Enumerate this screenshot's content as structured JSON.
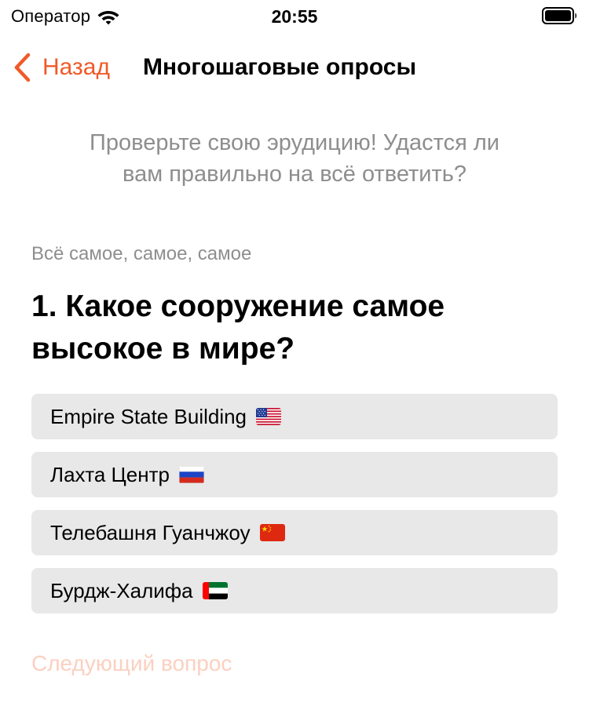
{
  "status_bar": {
    "carrier": "Оператор",
    "time": "20:55",
    "wifi_icon": "wifi-icon",
    "battery_icon": "battery-full-icon"
  },
  "nav": {
    "back_label": "Назад",
    "back_icon": "chevron-left-icon",
    "title": "Многошаговые опросы",
    "accent_color": "#f05a28"
  },
  "intro": {
    "line1": "Проверьте свою эрудицию! Удастся ли",
    "line2": "вам правильно на всё ответить?"
  },
  "quiz": {
    "section": "Всё самое, самое, самое",
    "question_line1": "1. Какое сооружение самое",
    "question_line2": "высокое в мире?",
    "answers": [
      {
        "label": "Empire State Building",
        "flag": "us-flag-icon"
      },
      {
        "label": "Лахта Центр",
        "flag": "ru-flag-icon"
      },
      {
        "label": "Телебашня Гуанчжоу",
        "flag": "cn-flag-icon"
      },
      {
        "label": "Бурдж-Халифа",
        "flag": "ae-flag-icon"
      }
    ],
    "next_label": "Следующий вопрос",
    "next_color_disabled": "#fbd0c0"
  }
}
